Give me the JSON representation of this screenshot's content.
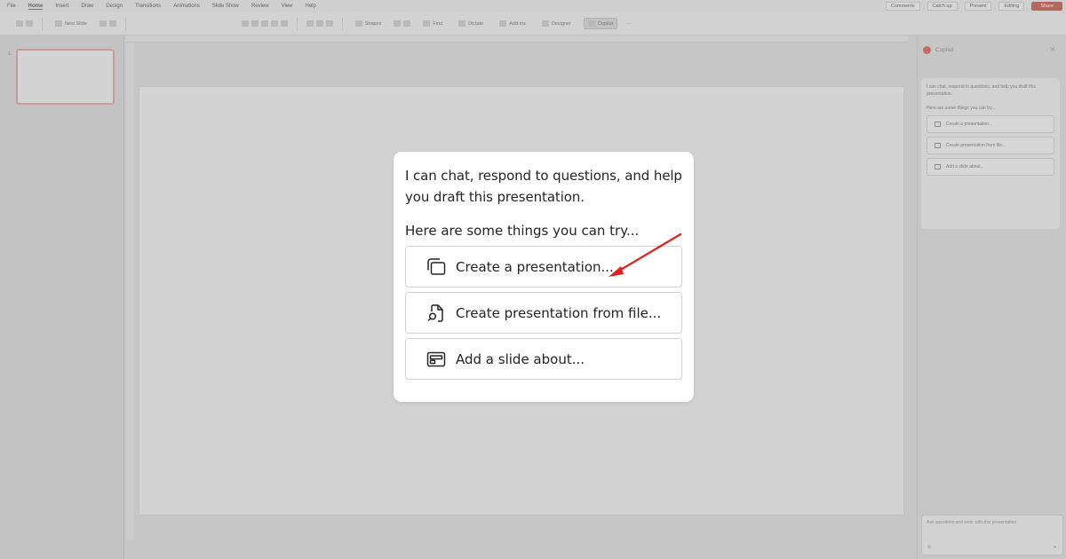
{
  "menubar": {
    "tabs": [
      "File",
      "Home",
      "Insert",
      "Draw",
      "Design",
      "Transitions",
      "Animations",
      "Slide Show",
      "Review",
      "View",
      "Help"
    ],
    "active_tab": "Home",
    "comments": "Comments",
    "catch_up": "Catch up",
    "present": "Present",
    "editing": "Editing",
    "share": "Share"
  },
  "ribbon": {
    "new_slide": "New Slide",
    "shapes": "Shapes",
    "find": "Find",
    "dictate": "Dictate",
    "add_ins": "Add-ins",
    "designer": "Designer",
    "copilot": "Copilot"
  },
  "thumbnails": {
    "slide_number": "1"
  },
  "copilot_pane": {
    "title": "Copilot",
    "intro": "I can chat, respond to questions, and help you draft this presentation.",
    "try": "Here are some things you can try...",
    "suggestions": [
      "Create a presentation...",
      "Create presentation from file...",
      "Add a slide about..."
    ],
    "input_placeholder": "Ask questions and work with this presentation"
  },
  "callout": {
    "intro": "I can chat, respond to questions, and help you draft this presentation.",
    "try": "Here are some things you can try...",
    "suggestions": [
      {
        "label": "Create a presentation...",
        "icon": "stacked-slides-icon"
      },
      {
        "label": "Create presentation from file...",
        "icon": "file-search-icon"
      },
      {
        "label": "Add a slide about...",
        "icon": "slide-layout-icon"
      }
    ],
    "arrow_color": "#e02020"
  }
}
